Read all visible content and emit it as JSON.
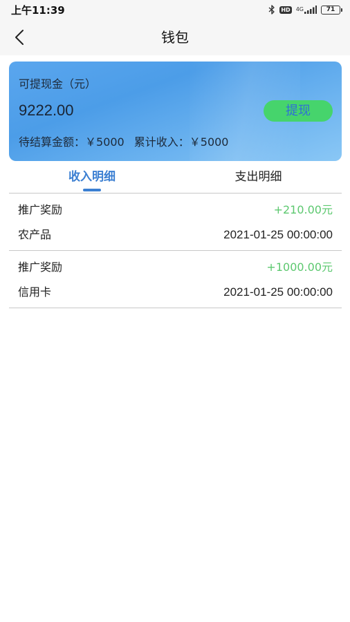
{
  "status_bar": {
    "time": "上午11:39",
    "hd_label": "HD",
    "network_label": "4G",
    "battery_level": "71",
    "icons": [
      "bluetooth-icon",
      "hd-icon",
      "signal-icon",
      "battery-icon"
    ]
  },
  "nav": {
    "title": "钱包",
    "back_icon": "chevron-left-icon"
  },
  "card": {
    "withdrawable_label": "可提现金（元）",
    "withdrawable_amount": "9222.00",
    "withdraw_button": "提现",
    "pending_label": "待结算金额：",
    "pending_value": "￥5000",
    "total_label": "累计收入：",
    "total_value": "￥5000"
  },
  "tabs": {
    "income": "收入明细",
    "expense": "支出明细",
    "active": "income"
  },
  "records": [
    {
      "title": "推广奖励",
      "amount": "+210.00元",
      "category": "农产品",
      "datetime": "2021-01-25 00:00:00"
    },
    {
      "title": "推广奖励",
      "amount": "+1000.00元",
      "category": "信用卡",
      "datetime": "2021-01-25 00:00:00"
    }
  ],
  "colors": {
    "accent": "#3b7fd2",
    "withdraw_button_bg": "#46d46c",
    "income_amount": "#5cc86f",
    "card_gradient_start": "#5aa6ee",
    "card_gradient_end": "#8ac7f5"
  }
}
